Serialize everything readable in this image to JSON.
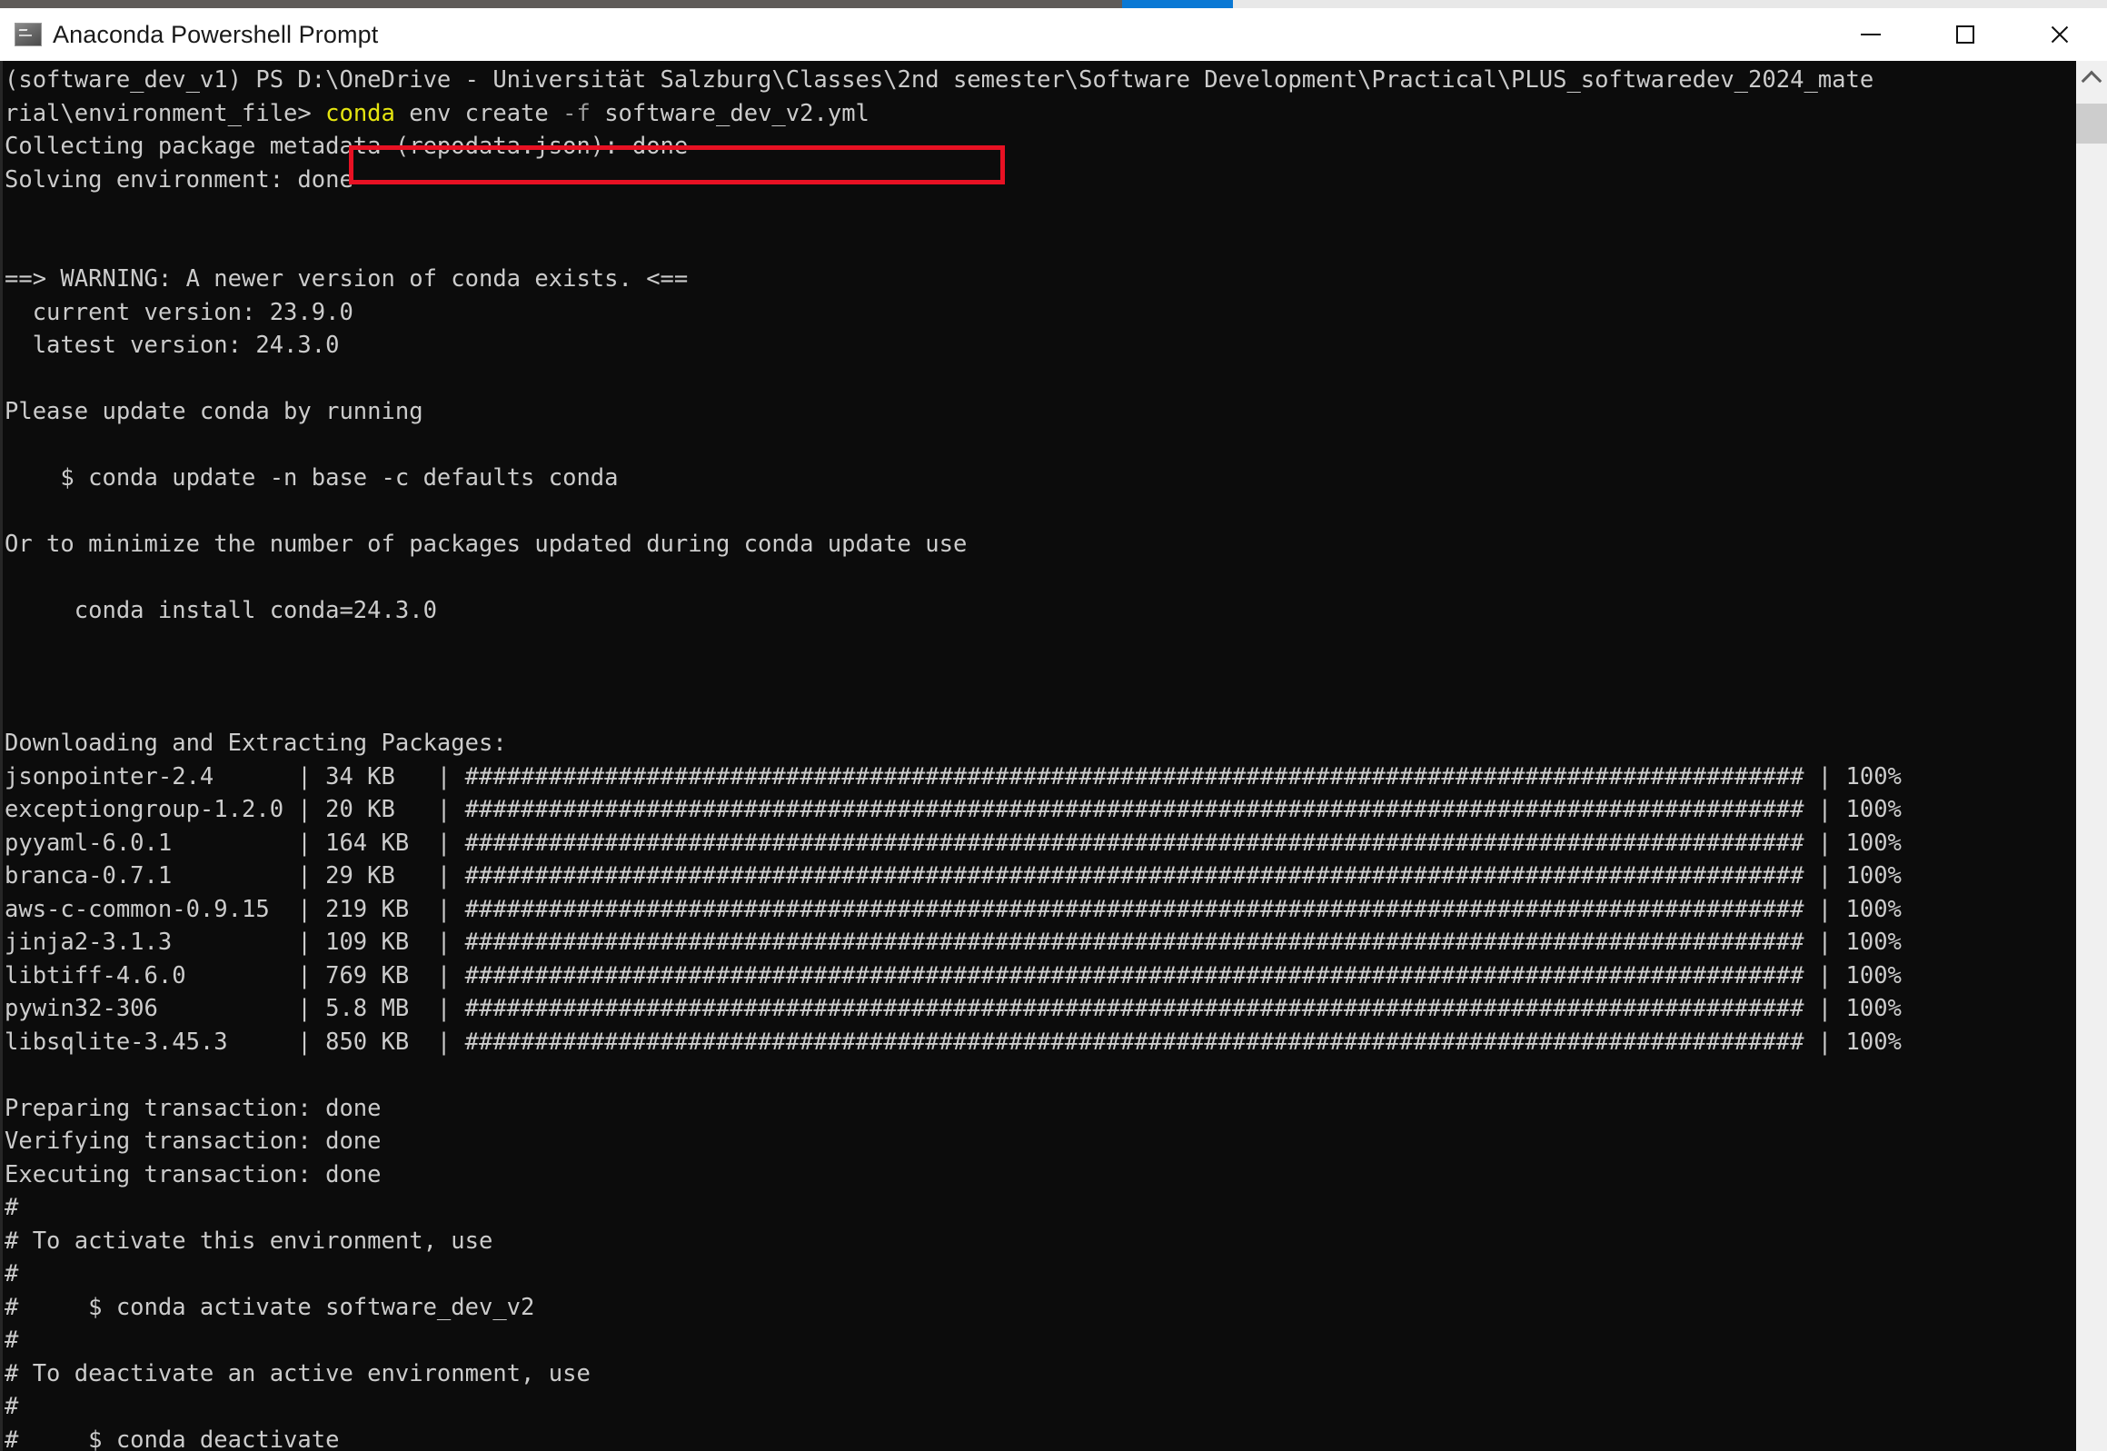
{
  "window": {
    "title": "Anaconda Powershell Prompt",
    "icon": "console-icon",
    "controls": {
      "minimize": "minimize-button",
      "maximize": "maximize-button",
      "close": "close-button"
    }
  },
  "colors": {
    "terminal_background": "#0c0c0c",
    "terminal_foreground": "#cccccc",
    "command_highlight": "#e5e510",
    "annotation_border": "#e81123",
    "accent_blue": "#0a78d4"
  },
  "annotation": {
    "type": "rectangle",
    "color": "#e81123",
    "target_text": "conda env create -f software_dev_v2.yml"
  },
  "scrollbar": {
    "up_arrow": "chevron-up-icon",
    "thumb_position": "near-top"
  },
  "terminal": {
    "prompt_env": "(software_dev_v1)",
    "prompt_shell": "PS",
    "prompt_path": "D:\\OneDrive - Universität Salzburg\\Classes\\2nd semester\\Software Development\\Practical\\PLUS_softwaredev_2024_material\\environment_file>",
    "command": {
      "program": "conda",
      "args": "env create",
      "flag": "-f",
      "file": "software_dev_v2.yml"
    },
    "line_1_wrapped_a": "(software_dev_v1) PS D:\\OneDrive - Universität Salzburg\\Classes\\2nd semester\\Software Development\\Practical\\PLUS_softwaredev_2024_mate",
    "line_1_wrapped_b": "rial\\environment_file>",
    "collecting": "Collecting package metadata (repodata.json): done",
    "solving": "Solving environment: done",
    "warning_header": "==> WARNING: A newer version of conda exists. <==",
    "current_version_line": "  current version: 23.9.0",
    "latest_version_line": "  latest version: 24.3.0",
    "current_version": "23.9.0",
    "latest_version": "24.3.0",
    "please_update": "Please update conda by running",
    "update_command": "    $ conda update -n base -c defaults conda",
    "minimize_note": "Or to minimize the number of packages updated during conda update use",
    "install_command": "     conda install conda=24.3.0",
    "downloading_header": "Downloading and Extracting Packages:",
    "packages": [
      {
        "name": "jsonpointer-2.4",
        "size": "34 KB",
        "progress": "100%"
      },
      {
        "name": "exceptiongroup-1.2.0",
        "size": "20 KB",
        "progress": "100%"
      },
      {
        "name": "pyyaml-6.0.1",
        "size": "164 KB",
        "progress": "100%"
      },
      {
        "name": "branca-0.7.1",
        "size": "29 KB",
        "progress": "100%"
      },
      {
        "name": "aws-c-common-0.9.15",
        "size": "219 KB",
        "progress": "100%"
      },
      {
        "name": "jinja2-3.1.3",
        "size": "109 KB",
        "progress": "100%"
      },
      {
        "name": "libtiff-4.6.0",
        "size": "769 KB",
        "progress": "100%"
      },
      {
        "name": "pywin32-306",
        "size": "5.8 MB",
        "progress": "100%"
      },
      {
        "name": "libsqlite-3.45.3",
        "size": "850 KB",
        "progress": "100%"
      }
    ],
    "progress_bar_fill": "################################################################################################",
    "preparing": "Preparing transaction: done",
    "verifying": "Verifying transaction: done",
    "executing": "Executing transaction: done",
    "activate_note": "# To activate this environment, use",
    "activate_command": "#     $ conda activate software_dev_v2",
    "deactivate_note": "# To deactivate an active environment, use",
    "deactivate_command": "#     $ conda deactivate",
    "hash_line": "#",
    "env_name_created": "software_dev_v2"
  }
}
